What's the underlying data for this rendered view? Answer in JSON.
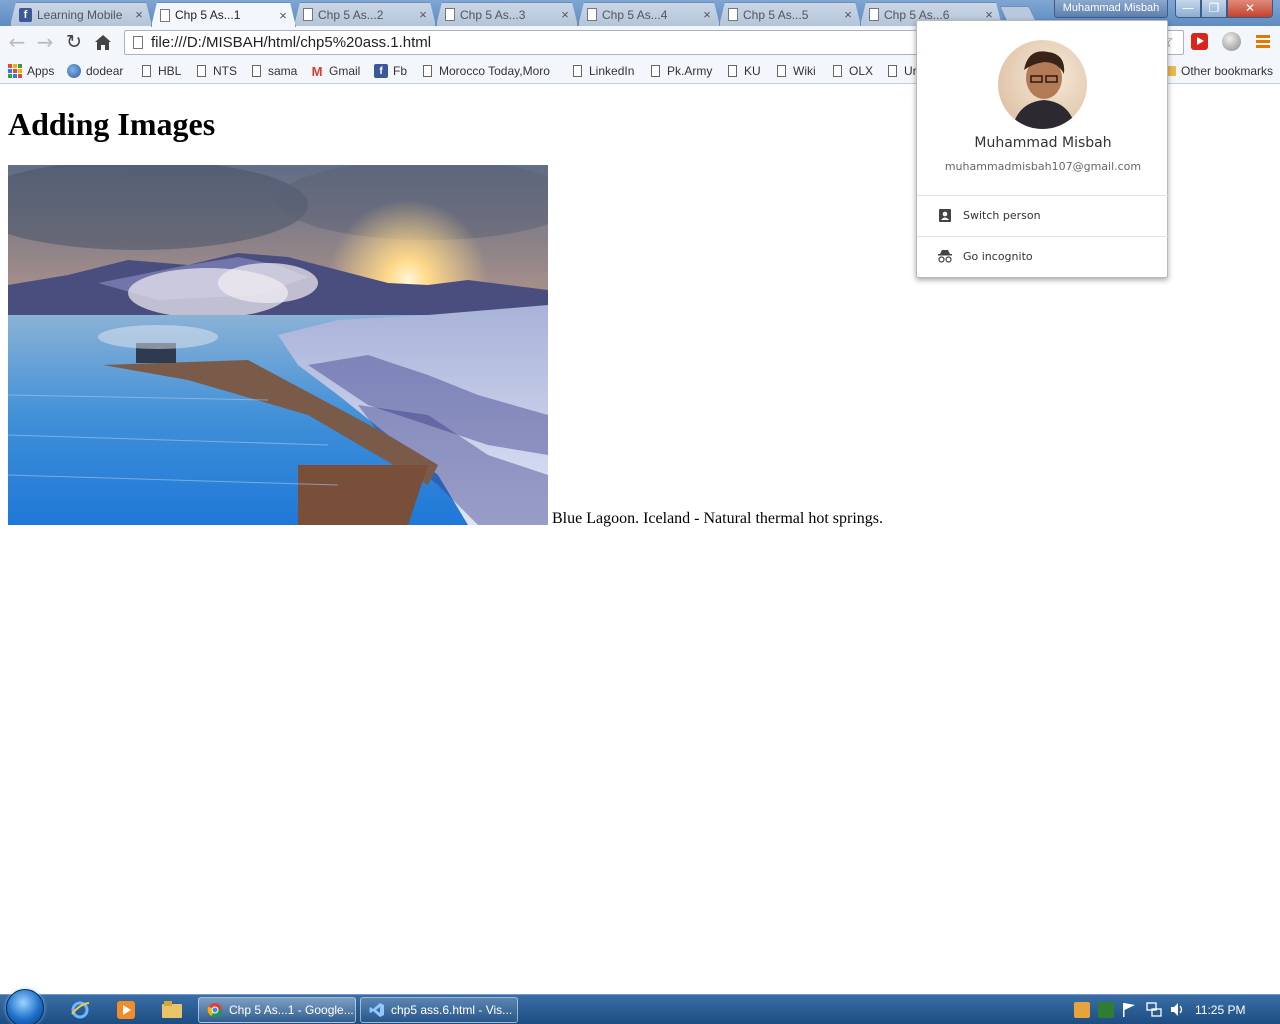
{
  "browser": {
    "tabs": [
      {
        "title": "Learning Mobile",
        "icon": "facebook-icon",
        "active": false
      },
      {
        "title": "Chp 5 As...1",
        "icon": "page-icon",
        "active": true
      },
      {
        "title": "Chp 5 As...2",
        "icon": "page-icon",
        "active": false
      },
      {
        "title": "Chp 5 As...3",
        "icon": "page-icon",
        "active": false
      },
      {
        "title": "Chp 5 As...4",
        "icon": "page-icon",
        "active": false
      },
      {
        "title": "Chp 5 As...5",
        "icon": "page-icon",
        "active": false
      },
      {
        "title": "Chp 5 As...6",
        "icon": "page-icon",
        "active": false
      }
    ],
    "tab_close_glyph": "×",
    "profile_badge": "Muhammad Misbah",
    "window_buttons": {
      "minimize": "—",
      "maximize": "❐",
      "close": "✕"
    },
    "address": "file:///D:/MISBAH/html/chp5%20ass.1.html",
    "bookmarks": [
      {
        "label": "Apps",
        "icon": "apps-grid-icon"
      },
      {
        "label": "dodear",
        "icon": "dodear-icon"
      },
      {
        "label": "HBL",
        "icon": "page-icon"
      },
      {
        "label": "NTS",
        "icon": "page-icon"
      },
      {
        "label": "sama",
        "icon": "page-icon"
      },
      {
        "label": "Gmail",
        "icon": "gmail-icon"
      },
      {
        "label": "Fb",
        "icon": "facebook-icon"
      },
      {
        "label": "Morocco Today,Moro",
        "icon": "page-icon"
      },
      {
        "label": "LinkedIn",
        "icon": "page-icon"
      },
      {
        "label": "Pk.Army",
        "icon": "page-icon"
      },
      {
        "label": "KU",
        "icon": "page-icon"
      },
      {
        "label": "Wiki",
        "icon": "page-icon"
      },
      {
        "label": "OLX",
        "icon": "page-icon"
      },
      {
        "label": "Ur",
        "icon": "page-icon"
      }
    ],
    "other_bookmarks": "Other bookmarks"
  },
  "page": {
    "heading": "Adding Images",
    "caption": "Blue Lagoon. Iceland - Natural thermal hot springs."
  },
  "profile_popup": {
    "name": "Muhammad Misbah",
    "email": "muhammadmisbah107@gmail.com",
    "switch_person": "Switch person",
    "go_incognito": "Go incognito"
  },
  "taskbar": {
    "tasks": [
      {
        "label": "Chp 5 As...1 - Google...",
        "icon": "chrome-icon"
      },
      {
        "label": "chp5 ass.6.html - Vis...",
        "icon": "visual-studio-icon"
      }
    ],
    "clock": "11:25 PM"
  },
  "colors": {
    "titlebar": "#6a95c9",
    "toolbar": "#f3f6fa",
    "taskbar": "#1d4d82",
    "accent_menu": "#e07b00"
  }
}
